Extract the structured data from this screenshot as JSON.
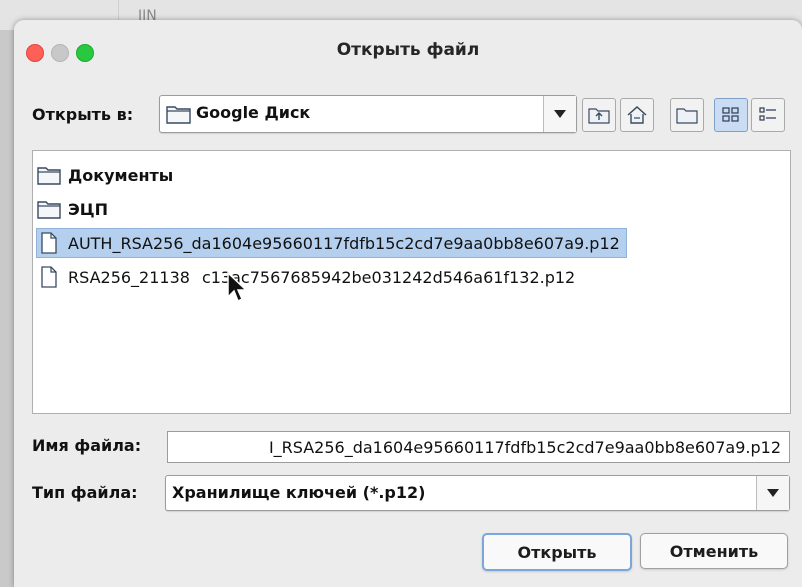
{
  "background": {
    "text": "IIN"
  },
  "dialog": {
    "title": "Открыть файл",
    "look_in": {
      "label": "Открыть в:",
      "value": "Google Диск"
    },
    "toolbar": {
      "buttons": [
        "up-folder-icon",
        "home-icon",
        "new-folder-icon",
        "list-view-icon",
        "details-view-icon"
      ],
      "active": "list-view-icon"
    },
    "files": [
      {
        "type": "folder",
        "name": "Документы",
        "selected": false
      },
      {
        "type": "folder",
        "name": "ЭЦП",
        "selected": false
      },
      {
        "type": "file",
        "name": "AUTH_RSA256_da1604e95660117fdfb15c2cd7e9aa0bb8e607a9.p12",
        "selected": true
      },
      {
        "type": "file",
        "name": "RSA256_21138",
        "name_rest": "c13ac7567685942be031242d546a61f132.p12",
        "selected": false
      }
    ],
    "file_name": {
      "label": "Имя файла:",
      "value": "I_RSA256_da1604e95660117fdfb15c2cd7e9aa0bb8e607a9.p12"
    },
    "file_type": {
      "label": "Тип файла:",
      "value": "Хранилище ключей (*.p12)"
    },
    "buttons": {
      "open": "Открыть",
      "cancel": "Отменить"
    }
  },
  "colors": {
    "selection": "#b5cfee",
    "close": "#fe5f57",
    "zoom": "#28c840"
  }
}
